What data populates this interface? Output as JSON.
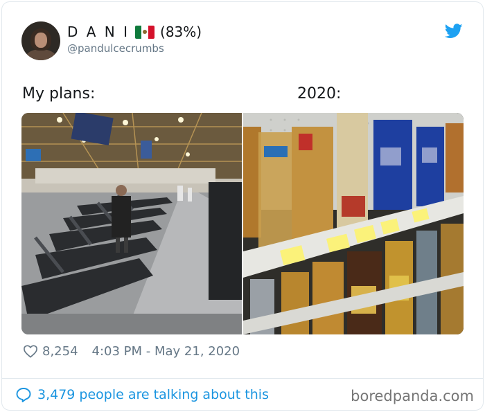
{
  "tweet": {
    "display_name": "D A N I",
    "percent": "(83%)",
    "handle": "@pandulcecrumbs",
    "caption_left": "My plans:",
    "caption_right": "2020:",
    "likes": "8,254",
    "timestamp": "4:03 PM - May 21, 2020",
    "conversation": "3,479 people are talking about this"
  },
  "images": {
    "left": "gym-treadmills-photo",
    "right": "liquor-shelf-photo"
  },
  "icons": {
    "platform": "twitter-bird-icon",
    "like": "heart-icon",
    "reply": "speech-bubble-icon",
    "flag": "mexico-flag-icon"
  },
  "colors": {
    "brand": "#1da1f2",
    "link": "#1b95e0",
    "muted": "#657786"
  },
  "watermark": "boredpanda.com"
}
